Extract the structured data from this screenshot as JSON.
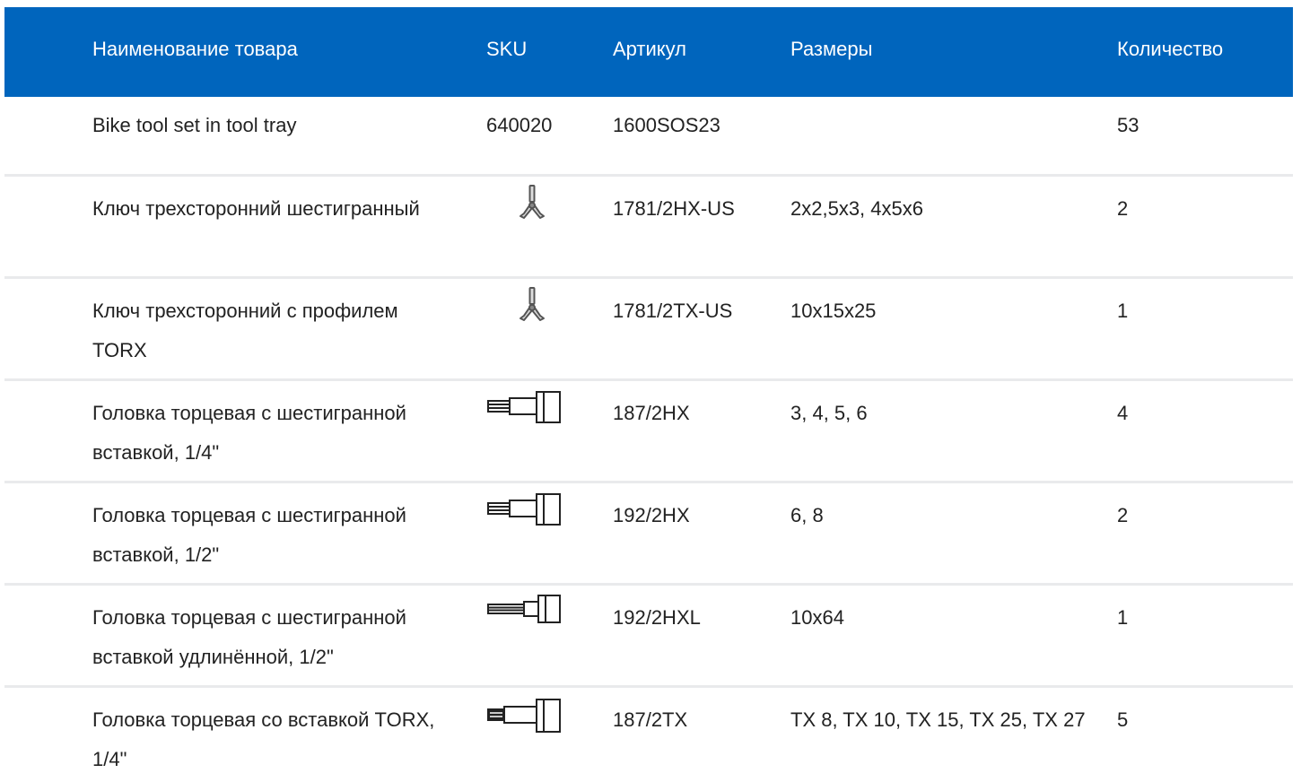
{
  "table": {
    "columns": {
      "name": "Наименование товара",
      "sku": "SKU",
      "article": "Артикул",
      "sizes": "Размеры",
      "quantity": "Количество"
    },
    "rows": [
      {
        "name": "Bike tool set in tool tray",
        "sku": "640020",
        "icon": "",
        "article": "1600SOS23",
        "sizes": "",
        "quantity": "53"
      },
      {
        "name": "Ключ трехсторонний шестигранный",
        "sku": "",
        "icon": "y-wrench-icon",
        "article": "1781/2HX-US",
        "sizes": "2x2,5x3, 4x5x6",
        "quantity": "2"
      },
      {
        "name": "Ключ трехсторонний с профилем TORX",
        "sku": "",
        "icon": "y-wrench-icon",
        "article": "1781/2TX-US",
        "sizes": "10x15x25",
        "quantity": "1"
      },
      {
        "name": "Головка торцевая с шестигранной вставкой, 1/4\"",
        "sku": "",
        "icon": "hex-socket-bit-icon",
        "article": "187/2HX",
        "sizes": "3, 4, 5, 6",
        "quantity": "4"
      },
      {
        "name": "Головка торцевая с шестигранной вставкой, 1/2\"",
        "sku": "",
        "icon": "hex-socket-bit-icon",
        "article": "192/2HX",
        "sizes": "6, 8",
        "quantity": "2"
      },
      {
        "name": "Головка торцевая с шестигранной вставкой удлинённой, 1/2\"",
        "sku": "",
        "icon": "long-hex-socket-bit-icon",
        "article": "192/2HXL",
        "sizes": "10x64",
        "quantity": "1"
      },
      {
        "name": "Головка торцевая со вставкой TORX, 1/4\"",
        "sku": "",
        "icon": "torx-socket-bit-icon",
        "article": "187/2TX",
        "sizes": "TX 8, TX 10, TX 15, TX 25, TX 27",
        "quantity": "5"
      }
    ]
  },
  "colors": {
    "header_bg": "#0065bd",
    "header_text": "#ffffff",
    "row_divider": "#e9eaec",
    "body_text": "#222222"
  }
}
